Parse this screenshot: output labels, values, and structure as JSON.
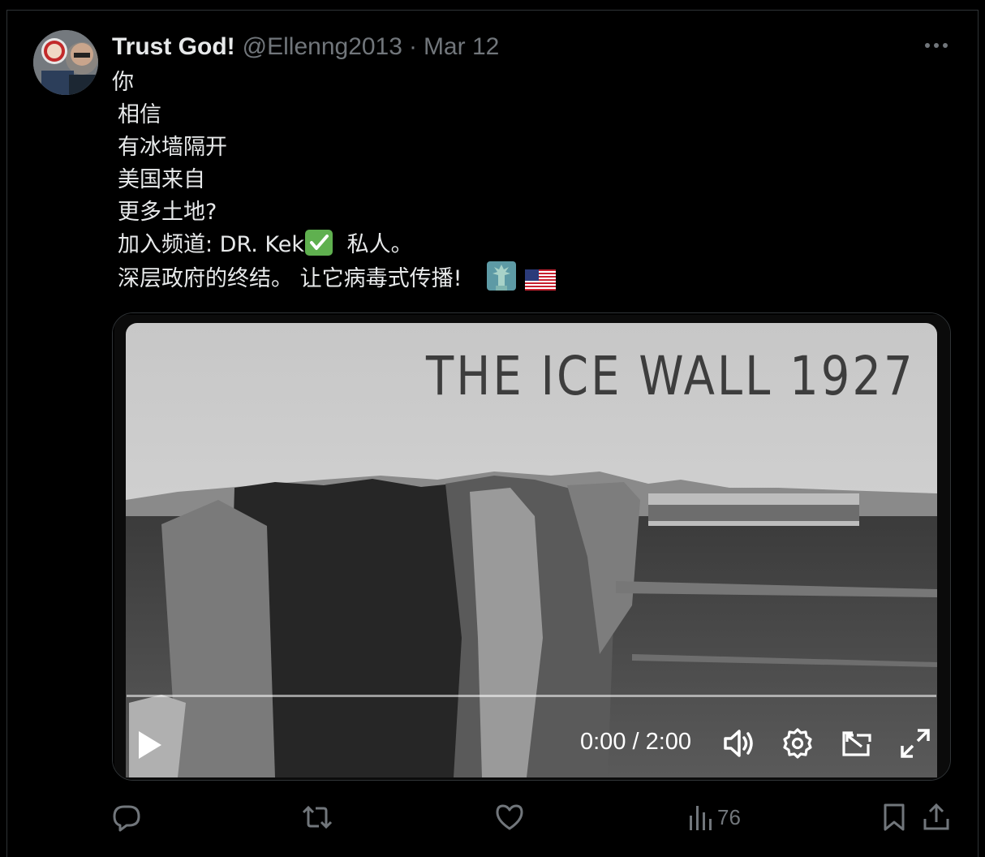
{
  "post": {
    "author_name": "Trust God!",
    "author_handle": "@Ellenng2013",
    "separator": "·",
    "date": "Mar 12",
    "text_lines": [
      "你",
      "相信",
      "有冰墙隔开",
      "美国来自",
      "更多土地?",
      "加入频道: DR.  Kek",
      "私人。",
      "深层政府的终结。 让它病毒式传播!"
    ]
  },
  "video": {
    "overlay_title": "THE ICE WALL 1927",
    "time": "0:00 / 2:00",
    "progress": 0
  },
  "actions": {
    "views_count": "76"
  },
  "icons": {
    "more": "more-icon",
    "play": "play-icon",
    "volume": "volume-icon",
    "settings": "gear-icon",
    "pip": "picture-in-picture-icon",
    "fullscreen": "fullscreen-icon",
    "reply": "reply-icon",
    "repost": "repost-icon",
    "like": "heart-icon",
    "views": "views-icon",
    "bookmark": "bookmark-icon",
    "share": "share-icon",
    "check": "check-mark-emoji-icon",
    "liberty": "statue-of-liberty-emoji-icon",
    "flag": "us-flag-emoji-icon"
  },
  "colors": {
    "background": "#000000",
    "primary_text": "#e7e9ea",
    "secondary_text": "#71767b",
    "border": "#2f3336",
    "check_emoji": "#5fb04f"
  }
}
